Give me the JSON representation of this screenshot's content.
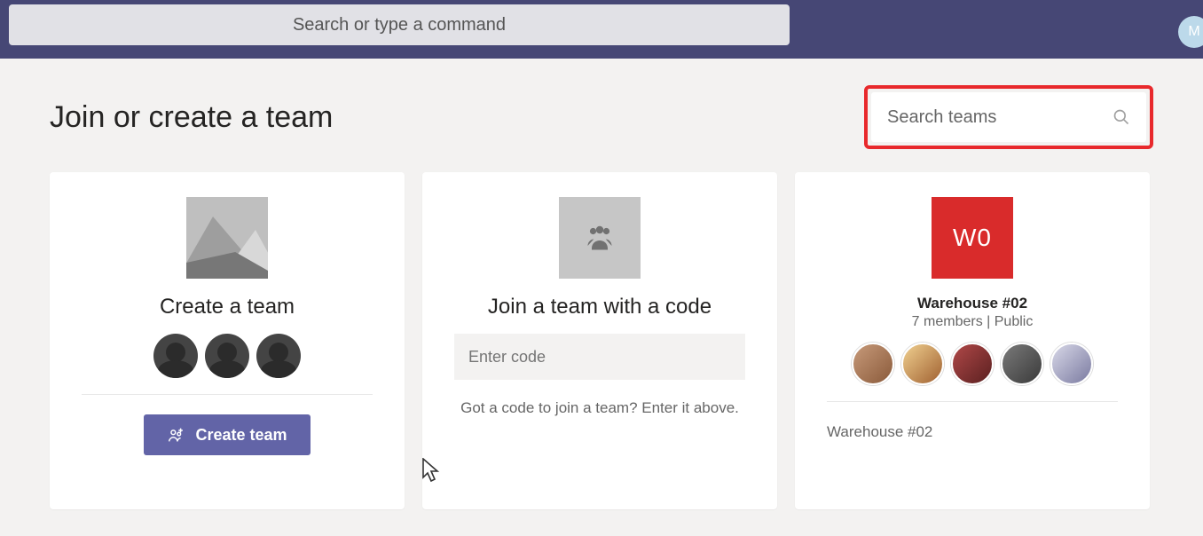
{
  "topbar": {
    "search_placeholder": "Search or type a command"
  },
  "page": {
    "title": "Join or create a team"
  },
  "search_teams": {
    "placeholder": "Search teams"
  },
  "create_card": {
    "title": "Create a team",
    "button_label": "Create team"
  },
  "join_card": {
    "title": "Join a team with a code",
    "code_placeholder": "Enter code",
    "help_text": "Got a code to join a team? Enter it above."
  },
  "team_card": {
    "initials": "W0",
    "name": "Warehouse #02",
    "meta": "7 members | Public",
    "footer": "Warehouse #02"
  }
}
